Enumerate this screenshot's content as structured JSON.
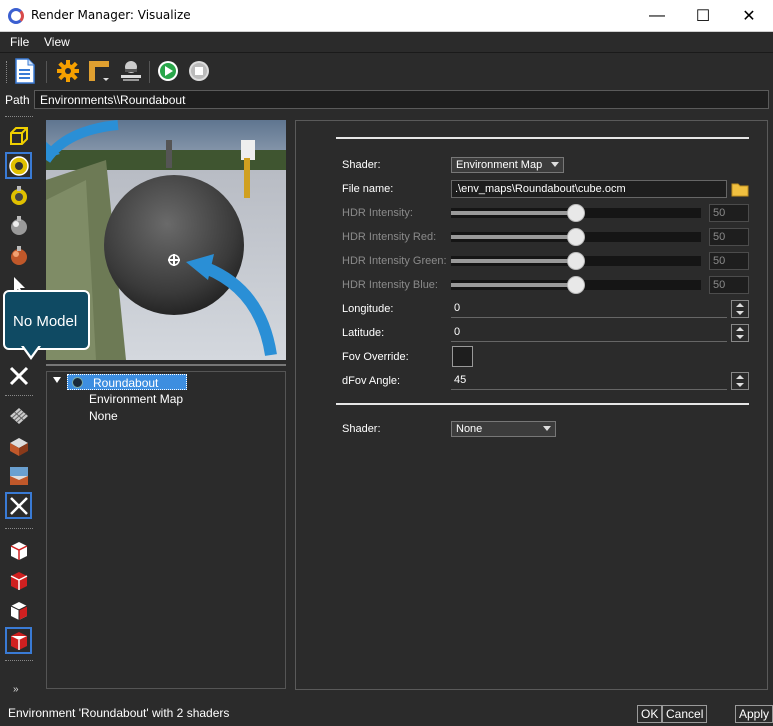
{
  "window": {
    "title": "Render Manager: Visualize",
    "minimize": "—",
    "maximize": "☐",
    "close": "✕"
  },
  "menu": {
    "file": "File",
    "view": "View"
  },
  "toolbar": {
    "icons": [
      "document-icon",
      "settings-gear-icon",
      "layout-icon",
      "render-stage-icon",
      "play-icon",
      "stop-icon"
    ]
  },
  "path": {
    "label": "Path",
    "value": "Environments\\\\Roundabout"
  },
  "callout": {
    "text": "No Model"
  },
  "tree": {
    "root": "Roundabout",
    "children": [
      "Environment Map",
      "None"
    ]
  },
  "panel": {
    "shader_label": "Shader:",
    "shader_value": "Environment Map",
    "file_label": "File name:",
    "file_value": ".\\env_maps\\Roundabout\\cube.ocm",
    "hdr_intensity_label": "HDR Intensity:",
    "hdr_intensity_value": "50",
    "hdr_red_label": "HDR Intensity Red:",
    "hdr_red_value": "50",
    "hdr_green_label": "HDR Intensity Green:",
    "hdr_green_value": "50",
    "hdr_blue_label": "HDR Intensity Blue:",
    "hdr_blue_value": "50",
    "slider_fraction": 0.5,
    "longitude_label": "Longitude:",
    "longitude_value": "0",
    "latitude_label": "Latitude:",
    "latitude_value": "0",
    "fov_override_label": "Fov Override:",
    "dfov_label": "dFov Angle:",
    "dfov_value": "45",
    "shader2_label": "Shader:",
    "shader2_value": "None"
  },
  "status": {
    "text": "Environment 'Roundabout' with 2 shaders",
    "ok": "OK",
    "cancel": "Cancel",
    "apply": "Apply"
  },
  "colors": {
    "background": "#2b2b2b",
    "accent": "#3a7bd5",
    "callout": "#0f4a63",
    "selection": "#3d8ee0"
  }
}
